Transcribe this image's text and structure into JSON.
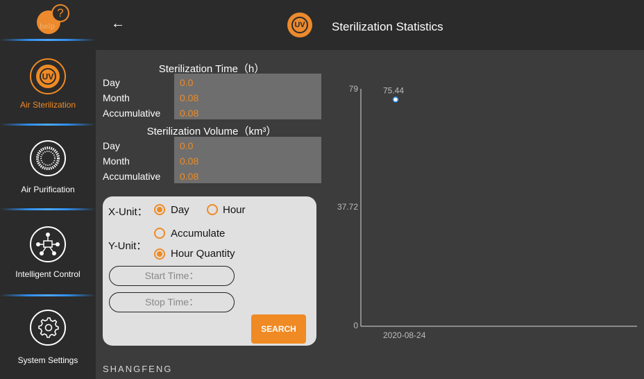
{
  "sidebar": {
    "help_label": "help",
    "items": [
      {
        "label": "Air Sterilization",
        "icon": "uv-icon",
        "active": true
      },
      {
        "label": "Air Purification",
        "icon": "purification-icon",
        "active": false
      },
      {
        "label": "Intelligent Control",
        "icon": "network-icon",
        "active": false
      },
      {
        "label": "System Settings",
        "icon": "gear-icon",
        "active": false
      }
    ]
  },
  "header": {
    "back_icon": "arrow-left-icon",
    "uv_badge": "UV",
    "title": "Sterilization Statistics"
  },
  "stats": {
    "time": {
      "title": "Sterilization Time（h）",
      "rows": [
        {
          "label": "Day",
          "value": "0.0"
        },
        {
          "label": "Month",
          "value": "0.08"
        },
        {
          "label": "Accumulative",
          "value": "0.08"
        }
      ]
    },
    "volume": {
      "title": "Sterilization Volume（km³）",
      "rows": [
        {
          "label": "Day",
          "value": "0.0"
        },
        {
          "label": "Month",
          "value": "0.08"
        },
        {
          "label": "Accumulative",
          "value": "0.08"
        }
      ]
    }
  },
  "filter": {
    "x_unit_label": "X-Unit：",
    "x_options": [
      {
        "label": "Day",
        "selected": true
      },
      {
        "label": "Hour",
        "selected": false
      }
    ],
    "y_unit_label": "Y-Unit：",
    "y_options": [
      {
        "label": "Accumulate",
        "selected": false
      },
      {
        "label": "Hour Quantity",
        "selected": true
      }
    ],
    "start_placeholder": "Start Time：",
    "stop_placeholder": "Stop Time：",
    "search_label": "SEARCH"
  },
  "brand": "SHANGFENG",
  "colors": {
    "accent": "#f08a24",
    "background": "#3c3c3c",
    "sidebar": "#2b2b2b",
    "panel": "#e0e0e0",
    "value_box": "#6e6e6e",
    "separator": "#2f8ff0"
  },
  "chart_data": {
    "type": "scatter",
    "x": [
      "2020-08-24"
    ],
    "y": [
      75.44
    ],
    "data_labels": [
      "75.44"
    ],
    "y_ticks": [
      "79",
      "37.72",
      "0"
    ],
    "ylim": [
      0,
      79
    ],
    "grid": false,
    "xlabel": "",
    "ylabel": ""
  }
}
